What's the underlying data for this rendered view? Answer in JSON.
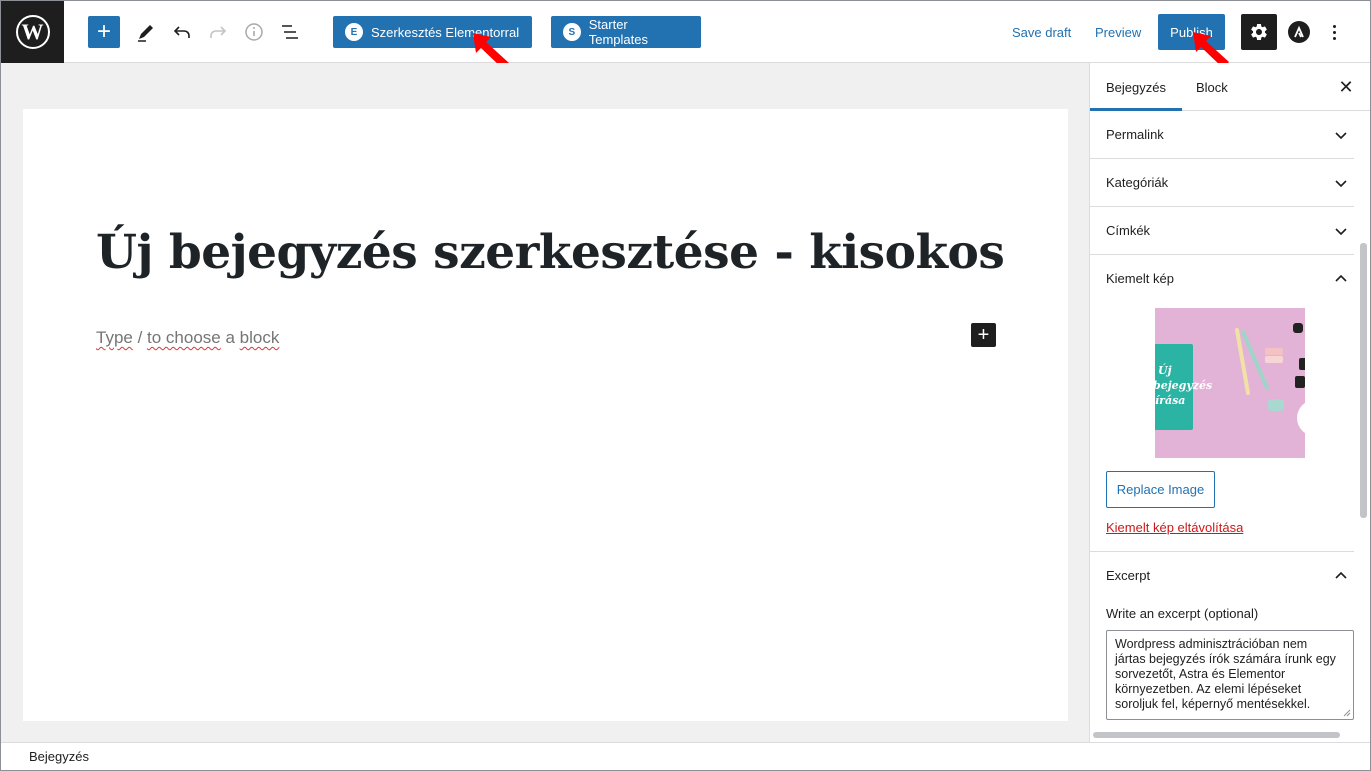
{
  "toolbar": {
    "logo": "W",
    "add_block": "+",
    "elementor_button": "Szerkesztés Elementorral",
    "elementor_icon": "E",
    "starter_templates_button": "Starter Templates",
    "starter_icon": "S",
    "save_draft": "Save draft",
    "preview": "Preview",
    "publish": "Publish",
    "icons": [
      "wordpress-logo-icon",
      "plus-icon",
      "pencil-icon",
      "undo-icon",
      "redo-icon",
      "info-icon",
      "list-view-icon",
      "gear-icon",
      "astra-icon",
      "more-vertical-icon"
    ]
  },
  "editor": {
    "title": "Új bejegyzés szerkesztése - kisokos",
    "placeholder_parts": [
      "Type",
      " / ",
      "to choose",
      " a ",
      "block"
    ],
    "inserter": "+"
  },
  "sidebar": {
    "tabs": [
      {
        "label": "Bejegyzés",
        "active": true
      },
      {
        "label": "Block",
        "active": false
      }
    ],
    "close": "✕",
    "panels": [
      {
        "label": "Permalink",
        "open": false
      },
      {
        "label": "Kategóriák",
        "open": false
      },
      {
        "label": "Címkék",
        "open": false
      },
      {
        "label": "Kiemelt kép",
        "open": true
      },
      {
        "label": "Excerpt",
        "open": true
      }
    ],
    "featured_image_text": [
      "Új",
      "bejegyzés",
      "írása"
    ],
    "replace_image": "Replace Image",
    "remove_image": "Kiemelt kép eltávolítása",
    "excerpt_hint": "Write an excerpt (optional)",
    "excerpt_lines": [
      "Wordpress adminisztrációban nem",
      "jártas bejegyzés írók számára írunk egy",
      "sorvezetőt, Astra és Elementor",
      "környezetben. Az elemi lépéseket",
      "soroljuk fel, képernyő mentésekkel."
    ]
  },
  "footer": {
    "breadcrumb": "Bejegyzés"
  },
  "colors": {
    "accent": "#2271b1",
    "dark": "#1e1e1e",
    "danger": "#cc1818",
    "arrow": "#ff0000"
  }
}
